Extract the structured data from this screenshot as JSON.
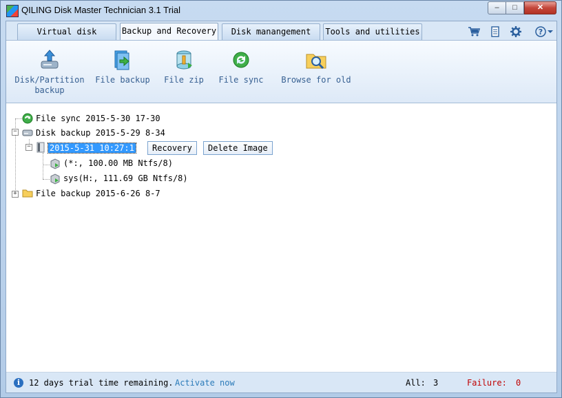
{
  "window": {
    "title": "QILING Disk Master Technician 3.1 Trial",
    "close_glyph": "✕",
    "max_glyph": "□",
    "min_glyph": "–"
  },
  "tabs": [
    {
      "label": "Virtual disk",
      "active": false
    },
    {
      "label": "Backup and Recovery",
      "active": true
    },
    {
      "label": "Disk manangement",
      "active": false
    },
    {
      "label": "Tools and utilities",
      "active": false
    }
  ],
  "top_icons": [
    "cart-icon",
    "document-icon",
    "gear-icon",
    "help-icon"
  ],
  "ribbon": {
    "disk_partition_line1": "Disk/Partition",
    "disk_partition_line2": "backup",
    "file_backup": "File backup",
    "file_zip": "File zip",
    "file_sync": "File sync",
    "browse_for_old": "Browse for old"
  },
  "tree": {
    "file_sync": "File sync 2015-5-30 17-30",
    "disk_backup": "Disk backup 2015-5-29 8-34",
    "image_node": "2015-5-31 10:27:1",
    "recovery_button": "Recovery",
    "delete_image_button": "Delete Image",
    "partition1": "(*:, 100.00 MB Ntfs/8)",
    "partition2": "sys(H:, 111.69 GB Ntfs/8)",
    "file_backup": "File backup 2015-6-26 8-7",
    "expander_minus": "−",
    "expander_plus": "+"
  },
  "status": {
    "info_glyph": "i",
    "trial_text": "12 days trial time remaining.",
    "activate_link": "Activate now",
    "all_label": "All:",
    "all_count": "3",
    "failure_label": "Failure:",
    "failure_count": "0"
  },
  "colors": {
    "accent_link": "#2b7bb9",
    "failure": "#c00000",
    "selection": "#3399ff",
    "ribbon_text": "#376092"
  }
}
